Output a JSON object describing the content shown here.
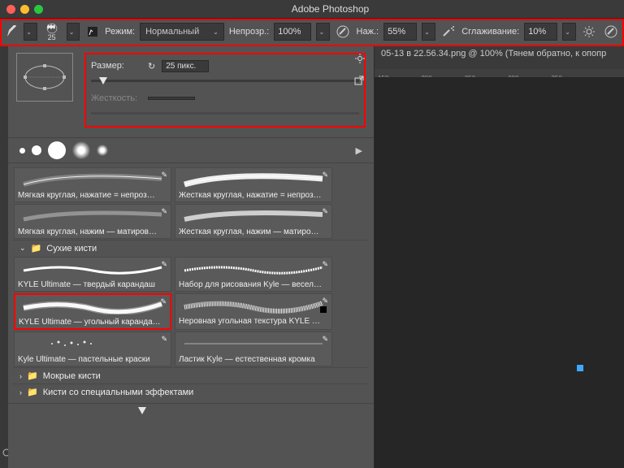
{
  "app": {
    "title": "Adobe Photoshop"
  },
  "optionsbar": {
    "brush_size_num": "25",
    "mode_label": "Режим:",
    "mode_value": "Нормальный",
    "opacity_label": "Непрозр.:",
    "opacity_value": "100%",
    "flow_label": "Наж.:",
    "flow_value": "55%",
    "smooth_label": "Сглаживание:",
    "smooth_value": "10%"
  },
  "brushpanel": {
    "size_label": "Размер:",
    "size_value": "25 пикс.",
    "hardness_label": "Жесткость:",
    "hardness_value": "",
    "folders": {
      "dry": "Сухие кисти",
      "wet": "Мокрые кисти",
      "fx": "Кисти со специальными эффектами"
    },
    "presets": [
      {
        "name": "Мягкая круглая, нажатие = непроз…"
      },
      {
        "name": "Жесткая круглая, нажатие = непроз…"
      },
      {
        "name": "Мягкая круглая, нажим — матиров…"
      },
      {
        "name": "Жесткая круглая, нажим — матиро…"
      },
      {
        "name": "KYLE Ultimate — твердый карандаш"
      },
      {
        "name": "Набор для рисования Kyle — весел…"
      },
      {
        "name": "KYLE Ultimate — угольный каранда…"
      },
      {
        "name": "Неровная угольная текстура KYLE …"
      },
      {
        "name": "Kyle Ultimate — пастельные краски"
      },
      {
        "name": "Ластик Kyle — естественная кромка"
      }
    ]
  },
  "document": {
    "tab": "05-13 в 22.56.34.png @ 100% (Тянем обратно,  к опопр"
  }
}
